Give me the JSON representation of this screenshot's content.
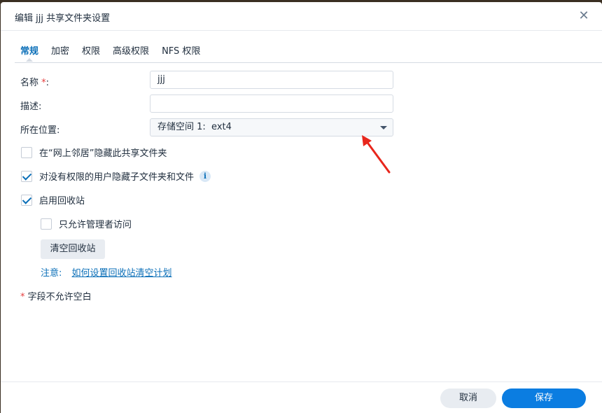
{
  "dialog": {
    "title": "编辑 jjj 共享文件夹设置",
    "close_symbol": "✕"
  },
  "tabs": [
    {
      "label": "常规",
      "active": true
    },
    {
      "label": "加密",
      "active": false
    },
    {
      "label": "权限",
      "active": false
    },
    {
      "label": "高级权限",
      "active": false
    },
    {
      "label": "NFS 权限",
      "active": false
    }
  ],
  "form": {
    "name": {
      "label": "名称",
      "required_mark": "*",
      "suffix": ":",
      "value": "jjj"
    },
    "description": {
      "label": "描述:",
      "value": ""
    },
    "location": {
      "label": "所在位置:",
      "value": "存储空间 1:  ext4"
    }
  },
  "options": {
    "hide_network": {
      "label": "在“网上邻居”隐藏此共享文件夹",
      "checked": false
    },
    "hide_subfolders": {
      "label": "对没有权限的用户隐藏子文件夹和文件",
      "checked": true
    },
    "enable_recycle": {
      "label": "启用回收站",
      "checked": true
    },
    "admin_only": {
      "label": "只允许管理者访问",
      "checked": false
    }
  },
  "recycle": {
    "empty_button": "清空回收站",
    "note_label": "注意:",
    "note_link": "如何设置回收站清空计划"
  },
  "footer_note": {
    "mark": "*",
    "text": " 字段不允许空白"
  },
  "footer": {
    "cancel": "取消",
    "save": "保存"
  },
  "colors": {
    "accent": "#0b7de1",
    "link": "#0b6fb8",
    "required": "#e64040",
    "annotation_arrow": "#e8261c"
  },
  "icons": {
    "info": "info-icon",
    "close": "close-icon",
    "dropdown": "chevron-down-icon"
  }
}
